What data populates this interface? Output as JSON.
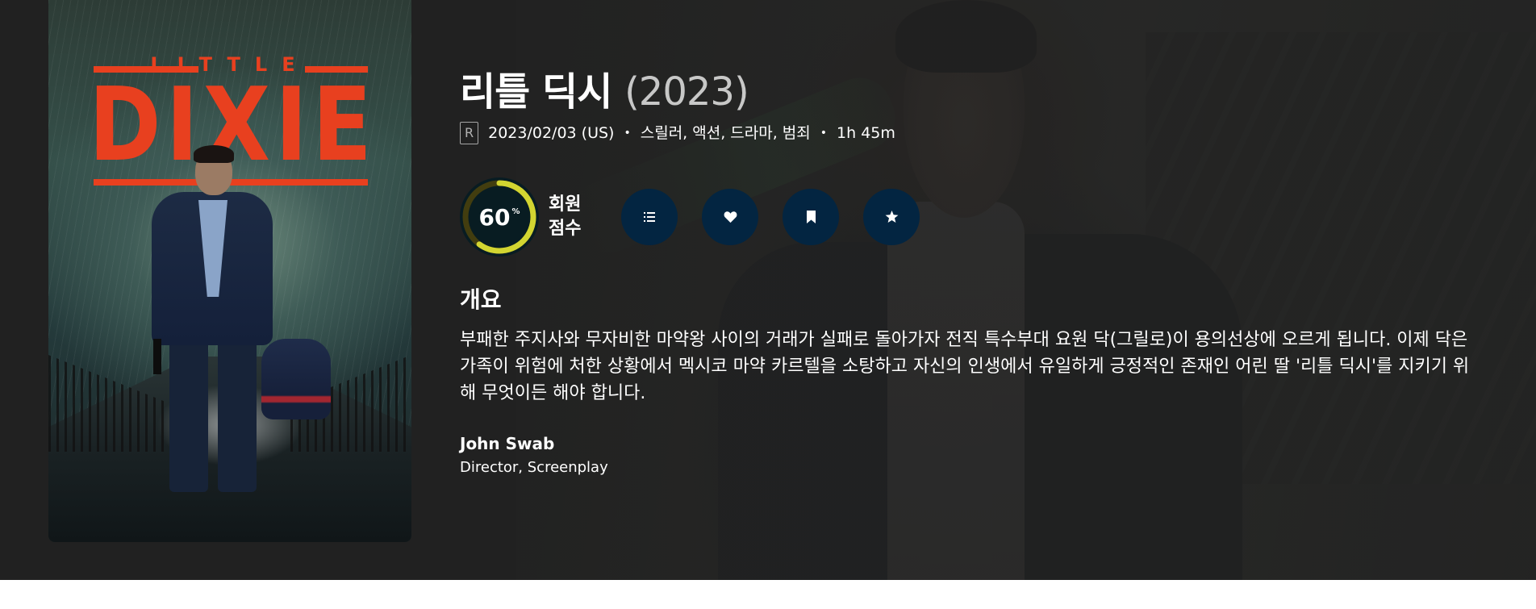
{
  "poster": {
    "title_small": "LITTLE",
    "title_big": "DIXIE"
  },
  "movie": {
    "title": "리틀 딕시",
    "year": "(2023)",
    "certification": "R",
    "release": "2023/02/03 (US)",
    "genres": "스릴러, 액션, 드라마, 범죄",
    "runtime": "1h 45m",
    "dot": "•"
  },
  "score": {
    "value": "60",
    "unit": "%",
    "fraction": 0.6,
    "label": "회원 점수",
    "ring_color": "#d2d531",
    "track_color": "#423d0f"
  },
  "actions": {
    "list_icon": "list-icon",
    "favorite_icon": "heart-icon",
    "watchlist_icon": "bookmark-icon",
    "rate_icon": "star-icon"
  },
  "overview": {
    "heading": "개요",
    "text": "부패한 주지사와 무자비한 마약왕 사이의 거래가 실패로 돌아가자 전직 특수부대 요원 닥(그릴로)이 용의선상에 오르게 됩니다. 이제 닥은 가족이 위험에 처한 상황에서 멕시코 마약 카르텔을 소탕하고 자신의 인생에서 유일하게 긍정적인 존재인 어린 딸 '리틀 딕시'를 지키기 위해 무엇이든 해야 합니다."
  },
  "crew": {
    "name": "John Swab",
    "role": "Director, Screenplay"
  }
}
